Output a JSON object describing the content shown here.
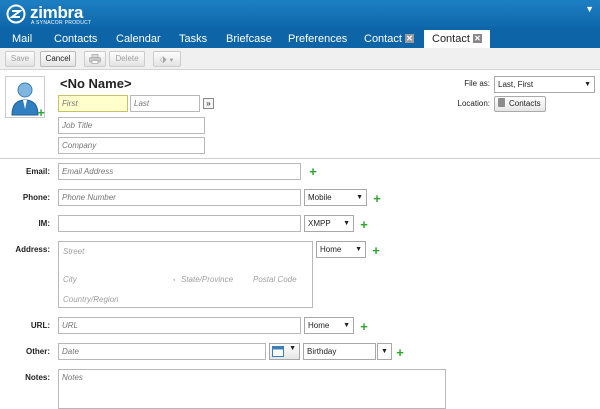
{
  "header": {
    "logo_text": "zimbra",
    "logo_sub": "A SYNACOR PRODUCT",
    "menu_arrow": "▼"
  },
  "tabs": [
    {
      "label": "Mail"
    },
    {
      "label": "Contacts"
    },
    {
      "label": "Calendar"
    },
    {
      "label": "Tasks"
    },
    {
      "label": "Briefcase"
    },
    {
      "label": "Preferences"
    },
    {
      "label": "Contact",
      "close": "✕"
    },
    {
      "label": "Contact",
      "close": "✕",
      "active": true
    }
  ],
  "toolbar": {
    "save": "Save",
    "cancel": "Cancel",
    "delete": "Delete"
  },
  "contact": {
    "name": "<No Name>",
    "first_placeholder": "First",
    "last_placeholder": "Last",
    "more_button": "»",
    "job_title_placeholder": "Job Title",
    "company_placeholder": "Company",
    "file_as_label": "File as:",
    "file_as_value": "Last, First",
    "location_label": "Location:",
    "location_value": "Contacts"
  },
  "fields": {
    "email_label": "Email:",
    "email_placeholder": "Email Address",
    "phone_label": "Phone:",
    "phone_placeholder": "Phone Number",
    "phone_type": "Mobile",
    "im_label": "IM:",
    "im_type": "XMPP",
    "address_label": "Address:",
    "street_placeholder": "Street",
    "city_placeholder": "City",
    "state_placeholder": "State/Province",
    "postal_placeholder": "Postal Code",
    "country_placeholder": "Country/Region",
    "address_type": "Home",
    "url_label": "URL:",
    "url_placeholder": "URL",
    "url_type": "Home",
    "other_label": "Other:",
    "date_placeholder": "Date",
    "other_type": "Birthday",
    "notes_label": "Notes:",
    "notes_placeholder": "Notes"
  },
  "colors": {
    "header_blue": "#1d7fc2",
    "tab_bar_blue": "#0d65a8",
    "plus_green": "#2fa52f",
    "focus_yellow": "#ffffcc"
  }
}
